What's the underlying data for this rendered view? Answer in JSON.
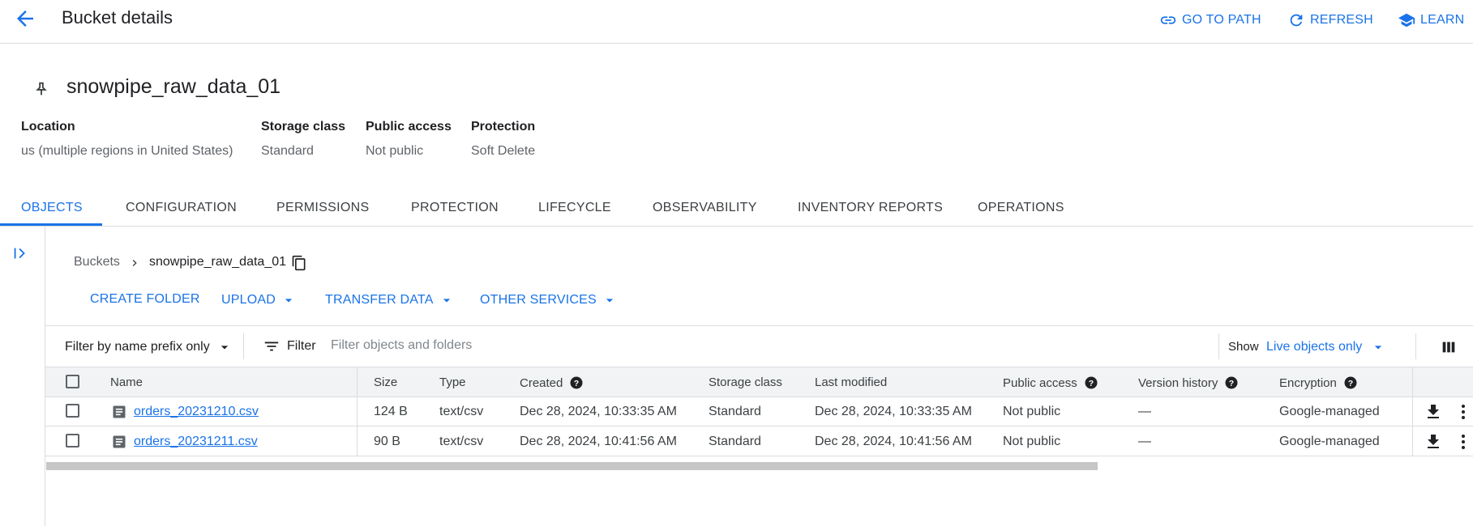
{
  "header": {
    "title": "Bucket details",
    "actions": {
      "go_to_path": "GO TO PATH",
      "refresh": "REFRESH",
      "learn": "LEARN"
    }
  },
  "bucket": {
    "name": "snowpipe_raw_data_01",
    "meta": {
      "location_label": "Location",
      "location_value": "us (multiple regions in United States)",
      "storage_label": "Storage class",
      "storage_value": "Standard",
      "public_label": "Public access",
      "public_value": "Not public",
      "protection_label": "Protection",
      "protection_value": "Soft Delete"
    }
  },
  "tabs": [
    "OBJECTS",
    "CONFIGURATION",
    "PERMISSIONS",
    "PROTECTION",
    "LIFECYCLE",
    "OBSERVABILITY",
    "INVENTORY REPORTS",
    "OPERATIONS"
  ],
  "active_tab": "OBJECTS",
  "breadcrumb": {
    "root": "Buckets",
    "current": "snowpipe_raw_data_01"
  },
  "object_actions": {
    "create_folder": "CREATE FOLDER",
    "upload": "UPLOAD",
    "transfer_data": "TRANSFER DATA",
    "other_services": "OTHER SERVICES"
  },
  "filter": {
    "prefix_mode": "Filter by name prefix only",
    "filter_label": "Filter",
    "placeholder": "Filter objects and folders",
    "show_label": "Show",
    "show_value": "Live objects only"
  },
  "table": {
    "columns": {
      "name": "Name",
      "size": "Size",
      "type": "Type",
      "created": "Created",
      "storage": "Storage class",
      "modified": "Last modified",
      "public": "Public access",
      "version": "Version history",
      "encryption": "Encryption"
    },
    "rows": [
      {
        "name": "orders_20231210.csv",
        "size": "124 B",
        "type": "text/csv",
        "created": "Dec 28, 2024, 10:33:35 AM",
        "storage": "Standard",
        "modified": "Dec 28, 2024, 10:33:35 AM",
        "public": "Not public",
        "version": "—",
        "encryption": "Google-managed"
      },
      {
        "name": "orders_20231211.csv",
        "size": "90 B",
        "type": "text/csv",
        "created": "Dec 28, 2024, 10:41:56 AM",
        "storage": "Standard",
        "modified": "Dec 28, 2024, 10:41:56 AM",
        "public": "Not public",
        "version": "—",
        "encryption": "Google-managed"
      }
    ]
  },
  "colors": {
    "accent": "#1a73e8",
    "text": "#202124",
    "muted": "#5f6368",
    "divider": "#dadce0",
    "header_bg": "#f1f3f4"
  },
  "icons": [
    "arrow-back-icon",
    "link-icon",
    "refresh-icon",
    "school-icon",
    "pin-icon",
    "expand-panel-icon",
    "chevron-right-icon",
    "copy-icon",
    "dropdown-arrow-icon",
    "filter-list-icon",
    "view-column-icon",
    "help-icon",
    "file-icon",
    "download-icon",
    "more-vert-icon"
  ]
}
